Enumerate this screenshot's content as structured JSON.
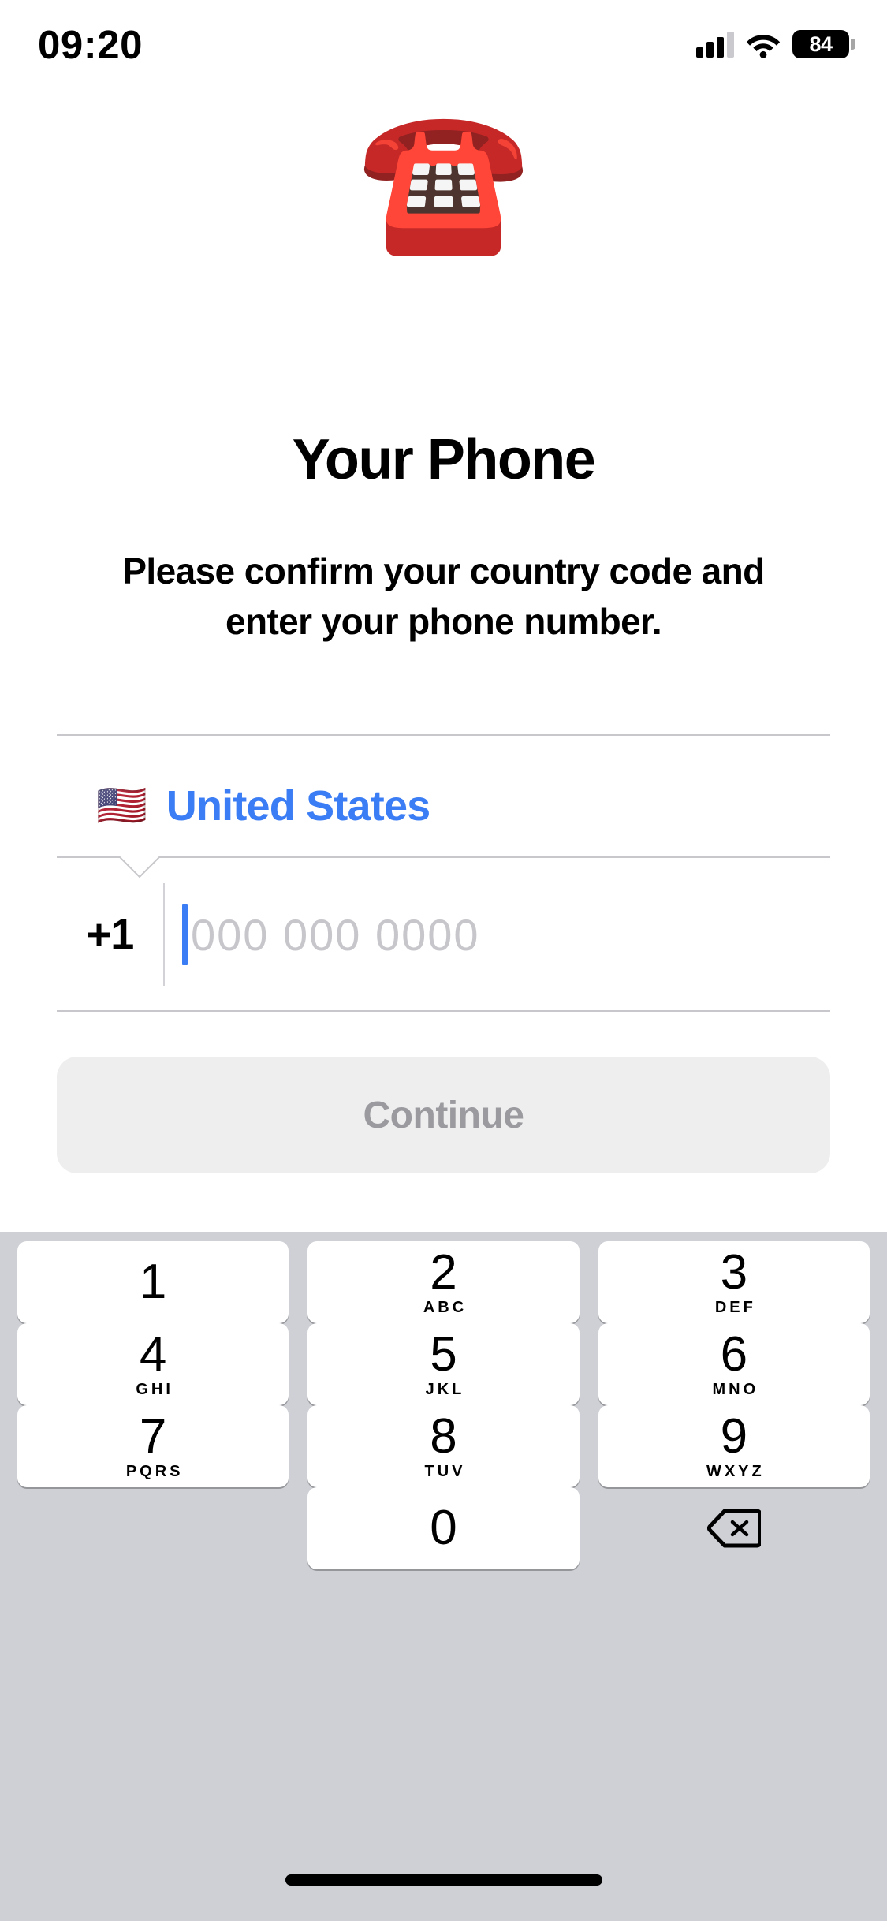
{
  "status_bar": {
    "time": "09:20",
    "signal_icon": "cellular-bars-icon",
    "wifi_icon": "wifi-icon",
    "battery_level": "84",
    "battery_icon": "battery-icon"
  },
  "hero": {
    "emoji": "☎️",
    "emoji_name": "telephone-emoji"
  },
  "page": {
    "title": "Your Phone",
    "subtitle": "Please confirm your country code and enter your phone number."
  },
  "form": {
    "country": {
      "flag": "🇺🇸",
      "name": "United States",
      "accent_color": "#3b7df4"
    },
    "phone": {
      "dial_code": "+1",
      "value": "",
      "placeholder": "000 000 0000",
      "caret_color": "#3b7df4",
      "placeholder_color": "#c6c6cb"
    },
    "divider_color": "#c8c8cc"
  },
  "continue_button": {
    "label": "Continue",
    "enabled": false,
    "background": "#eeeeef",
    "text_color": "#9a9a9f"
  },
  "keypad": {
    "background": "#ced0d6",
    "key_background": "#ffffff",
    "keys": [
      {
        "digit": "1",
        "letters": ""
      },
      {
        "digit": "2",
        "letters": "ABC"
      },
      {
        "digit": "3",
        "letters": "DEF"
      },
      {
        "digit": "4",
        "letters": "GHI"
      },
      {
        "digit": "5",
        "letters": "JKL"
      },
      {
        "digit": "6",
        "letters": "MNO"
      },
      {
        "digit": "7",
        "letters": "PQRS"
      },
      {
        "digit": "8",
        "letters": "TUV"
      },
      {
        "digit": "9",
        "letters": "WXYZ"
      },
      {
        "digit": "0",
        "letters": ""
      }
    ],
    "delete_icon": "backspace-delete-icon"
  },
  "home_indicator": "home-indicator-bar"
}
